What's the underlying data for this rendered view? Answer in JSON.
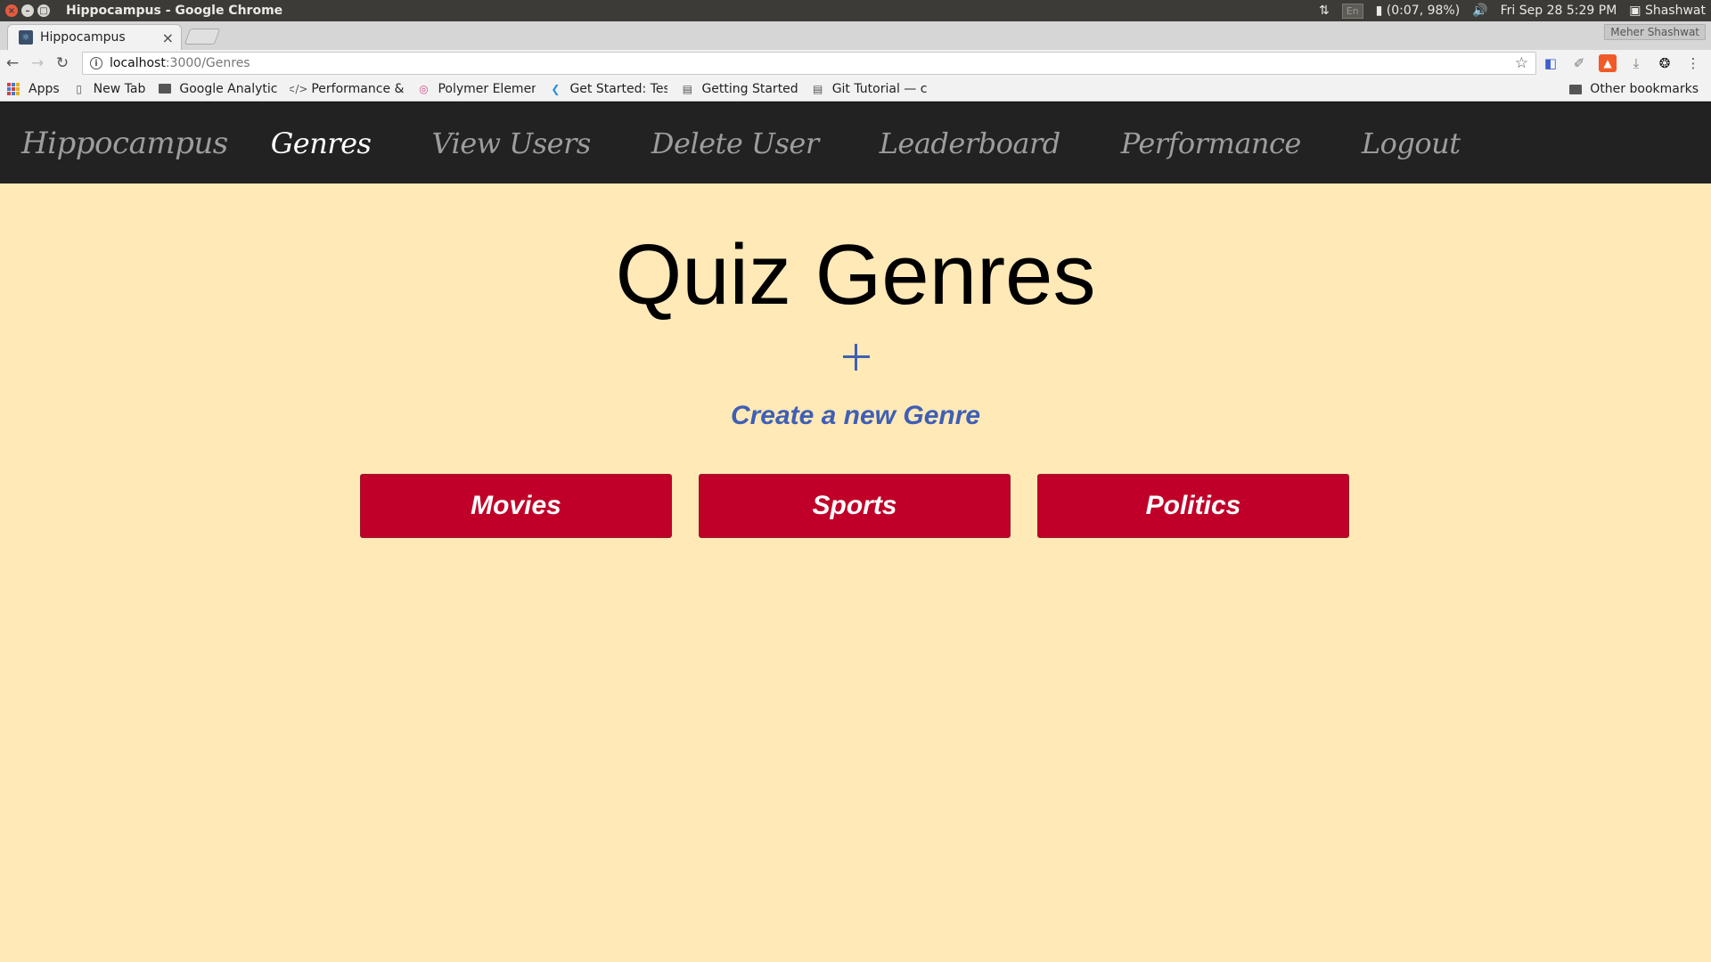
{
  "os": {
    "window_title": "Hippocampus - Google Chrome",
    "lang": "En",
    "battery": "(0:07, 98%)",
    "clock": "Fri Sep 28  5:29 PM",
    "user": "Shashwat"
  },
  "browser": {
    "tab_title": "Hippocampus",
    "profile": "Meher Shashwat",
    "url_host": "localhost",
    "url_path": ":3000/Genres",
    "bookmarks": [
      {
        "label": "Apps",
        "icon": "apps-grid-icon"
      },
      {
        "label": "New Tab",
        "icon": "page-icon"
      },
      {
        "label": "Google Analytic",
        "icon": "folder-icon"
      },
      {
        "label": "Performance &",
        "icon": "code-icon"
      },
      {
        "label": "Polymer Elemen",
        "icon": "polymer-icon"
      },
      {
        "label": "Get Started: Tes",
        "icon": "flutter-icon"
      },
      {
        "label": "Getting Started",
        "icon": "doc-icon"
      },
      {
        "label": "Git Tutorial — c",
        "icon": "doc-icon"
      }
    ],
    "other_bookmarks": "Other bookmarks"
  },
  "nav": {
    "brand": "Hippocampus",
    "links": [
      "Genres",
      "View Users",
      "Delete User",
      "Leaderboard",
      "Performance",
      "Logout"
    ],
    "active": "Genres"
  },
  "main": {
    "title": "Quiz Genres",
    "create_label": "Create a new Genre",
    "genres": [
      "Movies",
      "Sports",
      "Politics"
    ]
  },
  "colors": {
    "page_bg": "#ffe9b7",
    "navbar_bg": "#222222",
    "accent_blue": "#3f5fb5",
    "genre_red": "#c00028"
  }
}
